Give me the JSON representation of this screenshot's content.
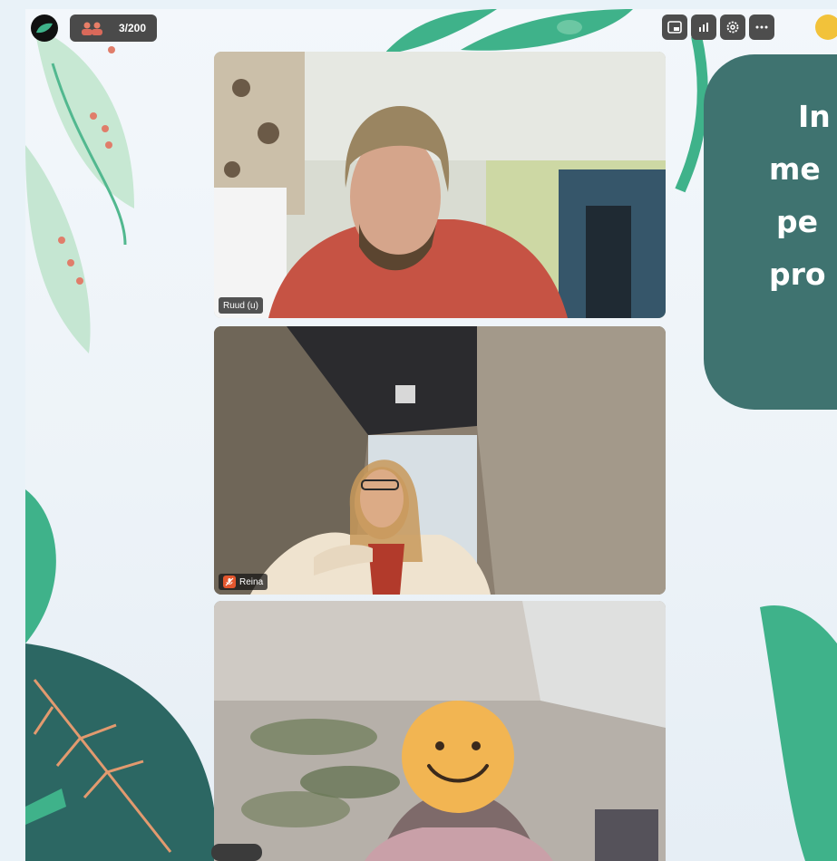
{
  "app": {
    "participant_count": "3/200"
  },
  "icons": {
    "logo": "app-logo-icon",
    "people": "participants-icon",
    "toolbar": [
      "picture-in-picture-icon",
      "stats-icon",
      "settings-icon",
      "more-icon"
    ]
  },
  "participants": [
    {
      "name": "Ruud (u)",
      "muted": false
    },
    {
      "name": "Reina",
      "muted": true
    },
    {
      "name": "",
      "muted": false,
      "face_covered_by": "smiley-emoji"
    }
  ],
  "bubble": {
    "lines": [
      "In",
      "me",
      "pe",
      "pro"
    ]
  },
  "colors": {
    "bubble": "#3f7370",
    "leaf_dark": "#2c6763",
    "leaf_green": "#3fb28a",
    "leaf_pale": "#bfe6cf",
    "accent_coral": "#e87e67"
  }
}
